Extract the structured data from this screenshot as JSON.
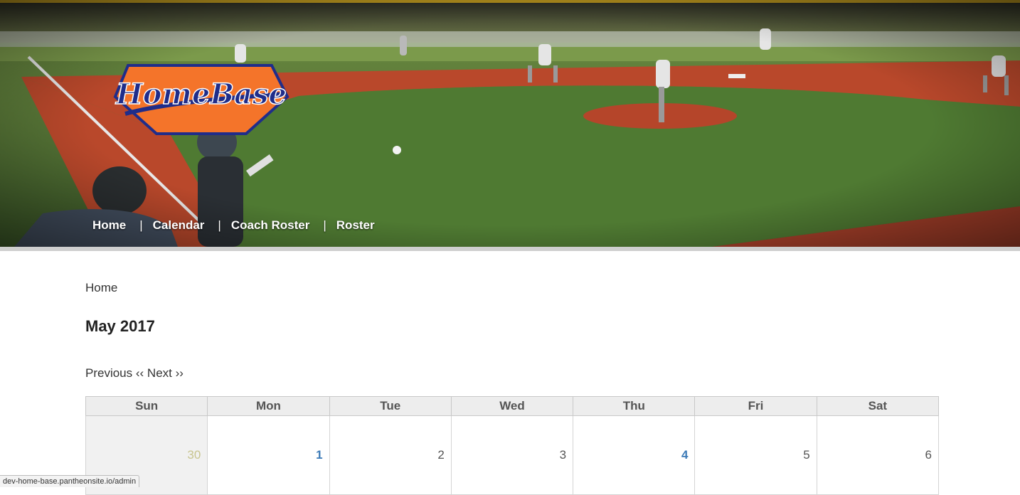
{
  "site": {
    "logo_text": "HomeBase",
    "colors": {
      "logo_orange": "#f4742a",
      "logo_blue": "#1f2d8a",
      "link_blue": "#3c7ab7",
      "other_month": "#c8c58f"
    }
  },
  "nav": {
    "items": [
      {
        "label": "Home"
      },
      {
        "label": "Calendar"
      },
      {
        "label": "Coach Roster"
      },
      {
        "label": "Roster"
      }
    ],
    "separator": "|"
  },
  "breadcrumb": {
    "label": "Home"
  },
  "page": {
    "title": "May 2017"
  },
  "pager": {
    "previous": "Previous ‹‹",
    "next": "Next ››"
  },
  "calendar": {
    "weekdays": [
      "Sun",
      "Mon",
      "Tue",
      "Wed",
      "Thu",
      "Fri",
      "Sat"
    ],
    "weeks": [
      [
        {
          "day": "30",
          "other_month": true
        },
        {
          "day": "1",
          "has_event": true
        },
        {
          "day": "2"
        },
        {
          "day": "3"
        },
        {
          "day": "4",
          "has_event": true
        },
        {
          "day": "5"
        },
        {
          "day": "6"
        }
      ]
    ]
  },
  "status_bar": {
    "url": "dev-home-base.pantheonsite.io/admin"
  }
}
